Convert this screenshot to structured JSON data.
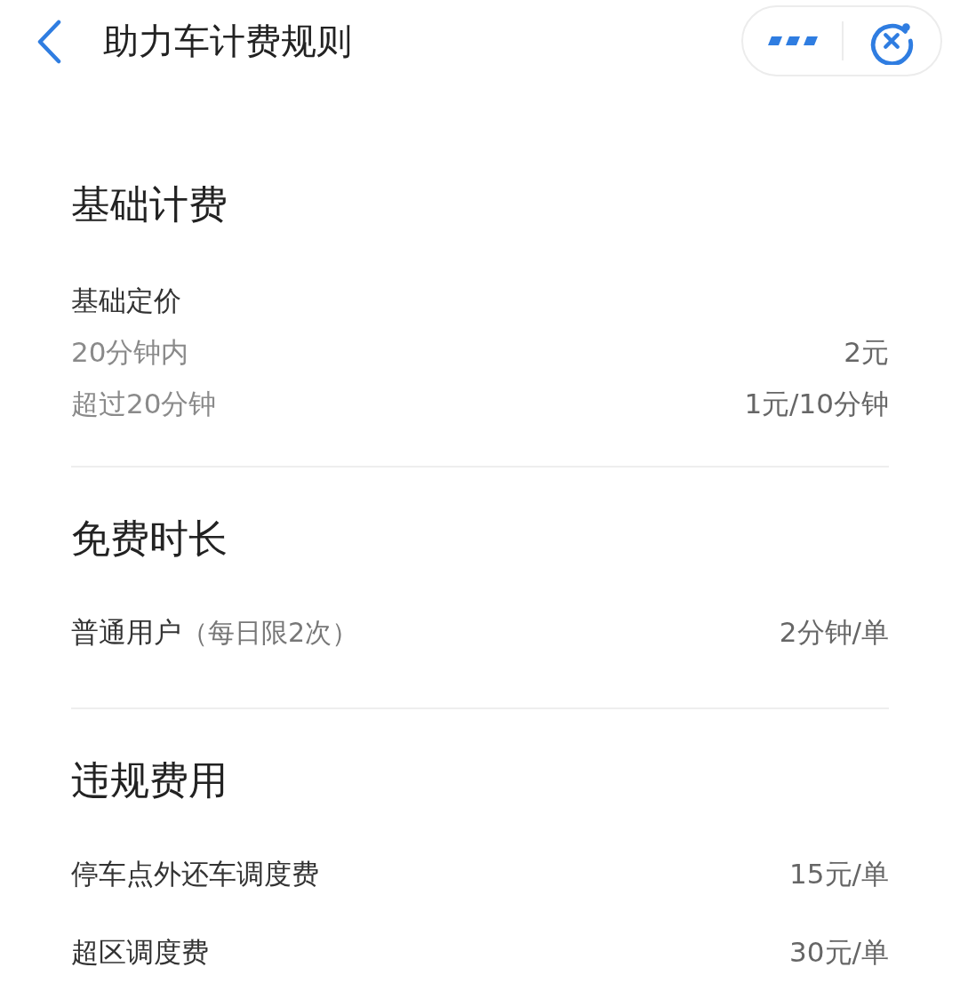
{
  "header": {
    "title": "助力车计费规则"
  },
  "sections": [
    {
      "title": "基础计费",
      "rows": [
        {
          "kind": "subheading",
          "label": "基础定价"
        },
        {
          "kind": "price",
          "muted": true,
          "label": "20分钟内",
          "value": "2元"
        },
        {
          "kind": "price",
          "muted": true,
          "label": "超过20分钟",
          "value": "1元/10分钟"
        }
      ]
    },
    {
      "title": "免费时长",
      "rows": [
        {
          "kind": "price",
          "muted": false,
          "label": "普通用户",
          "note": "（每日限2次）",
          "value": "2分钟/单"
        }
      ]
    },
    {
      "title": "违规费用",
      "rows": [
        {
          "kind": "price",
          "muted": false,
          "label": "停车点外还车调度费",
          "value": "15元/单"
        },
        {
          "kind": "price",
          "muted": false,
          "label": "超区调度费",
          "value": "30元/单"
        }
      ]
    }
  ]
}
